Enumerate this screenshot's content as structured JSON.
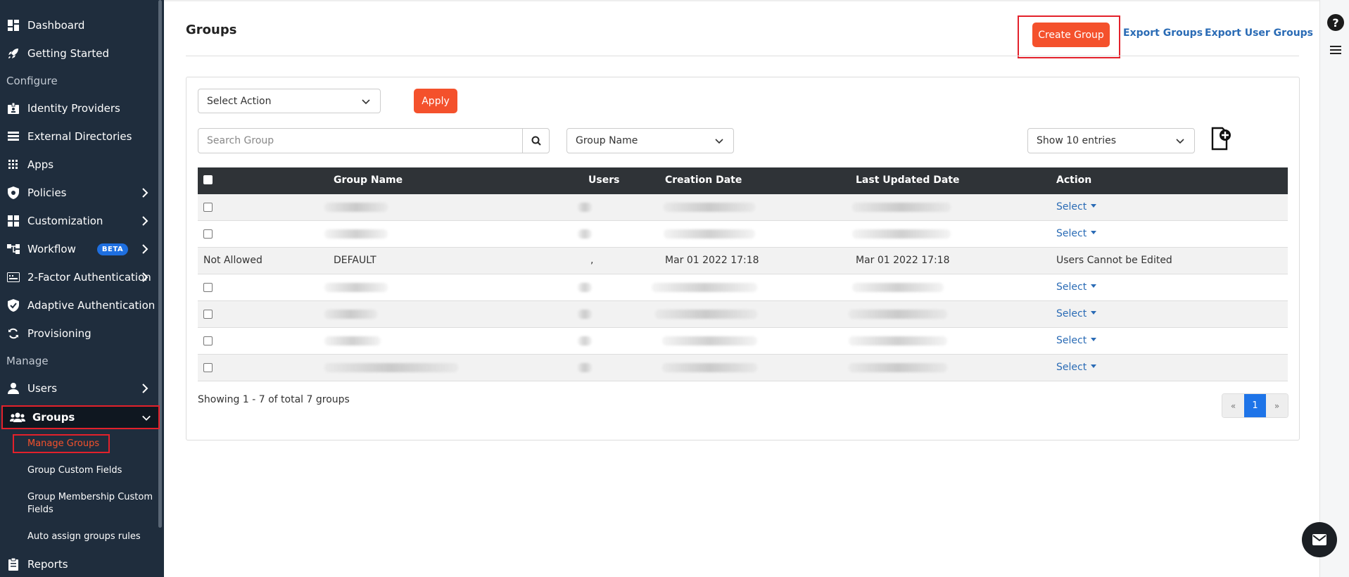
{
  "sidebar": {
    "items": [
      {
        "label": "Dashboard",
        "icon": "dashboard-icon"
      },
      {
        "label": "Getting Started",
        "icon": "rocket-icon"
      },
      {
        "label": "Identity Providers",
        "icon": "id-badge-icon"
      },
      {
        "label": "External Directories",
        "icon": "list-icon"
      },
      {
        "label": "Apps",
        "icon": "grid-icon"
      },
      {
        "label": "Policies",
        "icon": "shield-icon"
      },
      {
        "label": "Customization",
        "icon": "layout-icon"
      },
      {
        "label": "Workflow",
        "icon": "workflow-icon"
      },
      {
        "label": "2-Factor Authentication",
        "icon": "two-factor-icon"
      },
      {
        "label": "Adaptive Authentication",
        "icon": "shield-check-icon"
      },
      {
        "label": "Provisioning",
        "icon": "sync-icon"
      },
      {
        "label": "Users",
        "icon": "user-icon"
      },
      {
        "label": "Groups",
        "icon": "users-icon"
      },
      {
        "label": "Reports",
        "icon": "clipboard-icon"
      }
    ],
    "section_configure": "Configure",
    "section_manage": "Manage",
    "workflow_badge": "BETA",
    "groups_sub": [
      "Manage Groups",
      "Group Custom Fields",
      "Group Membership Custom Fields",
      "Auto assign groups rules"
    ]
  },
  "header": {
    "title": "Groups",
    "create_button": "Create Group",
    "export_groups": "Export Groups",
    "export_user_groups": "Export User Groups"
  },
  "toolbar": {
    "action_select": "Select Action",
    "apply": "Apply",
    "search_placeholder": "Search Group",
    "filter_select": "Group Name",
    "entries_select": "Show 10 entries"
  },
  "table": {
    "columns": [
      "Group Name",
      "Users",
      "Creation Date",
      "Last Updated Date",
      "Action"
    ],
    "default_row": {
      "first": "Not Allowed",
      "name": "DEFAULT",
      "users": ",",
      "created": "Mar 01 2022 17:18",
      "updated": "Mar 01 2022 17:18",
      "action": "Users Cannot be Edited"
    },
    "select_label": "Select"
  },
  "footer": {
    "showing": "Showing 1 - 7 of total 7 groups",
    "prev": "«",
    "page": "1",
    "next": "»"
  },
  "right_rail": {
    "help": "?"
  },
  "colors": {
    "sidebar": "#1f2d3d",
    "accent": "#f4512c",
    "link": "#2a6bb5",
    "highlight_border": "#e3212b"
  }
}
